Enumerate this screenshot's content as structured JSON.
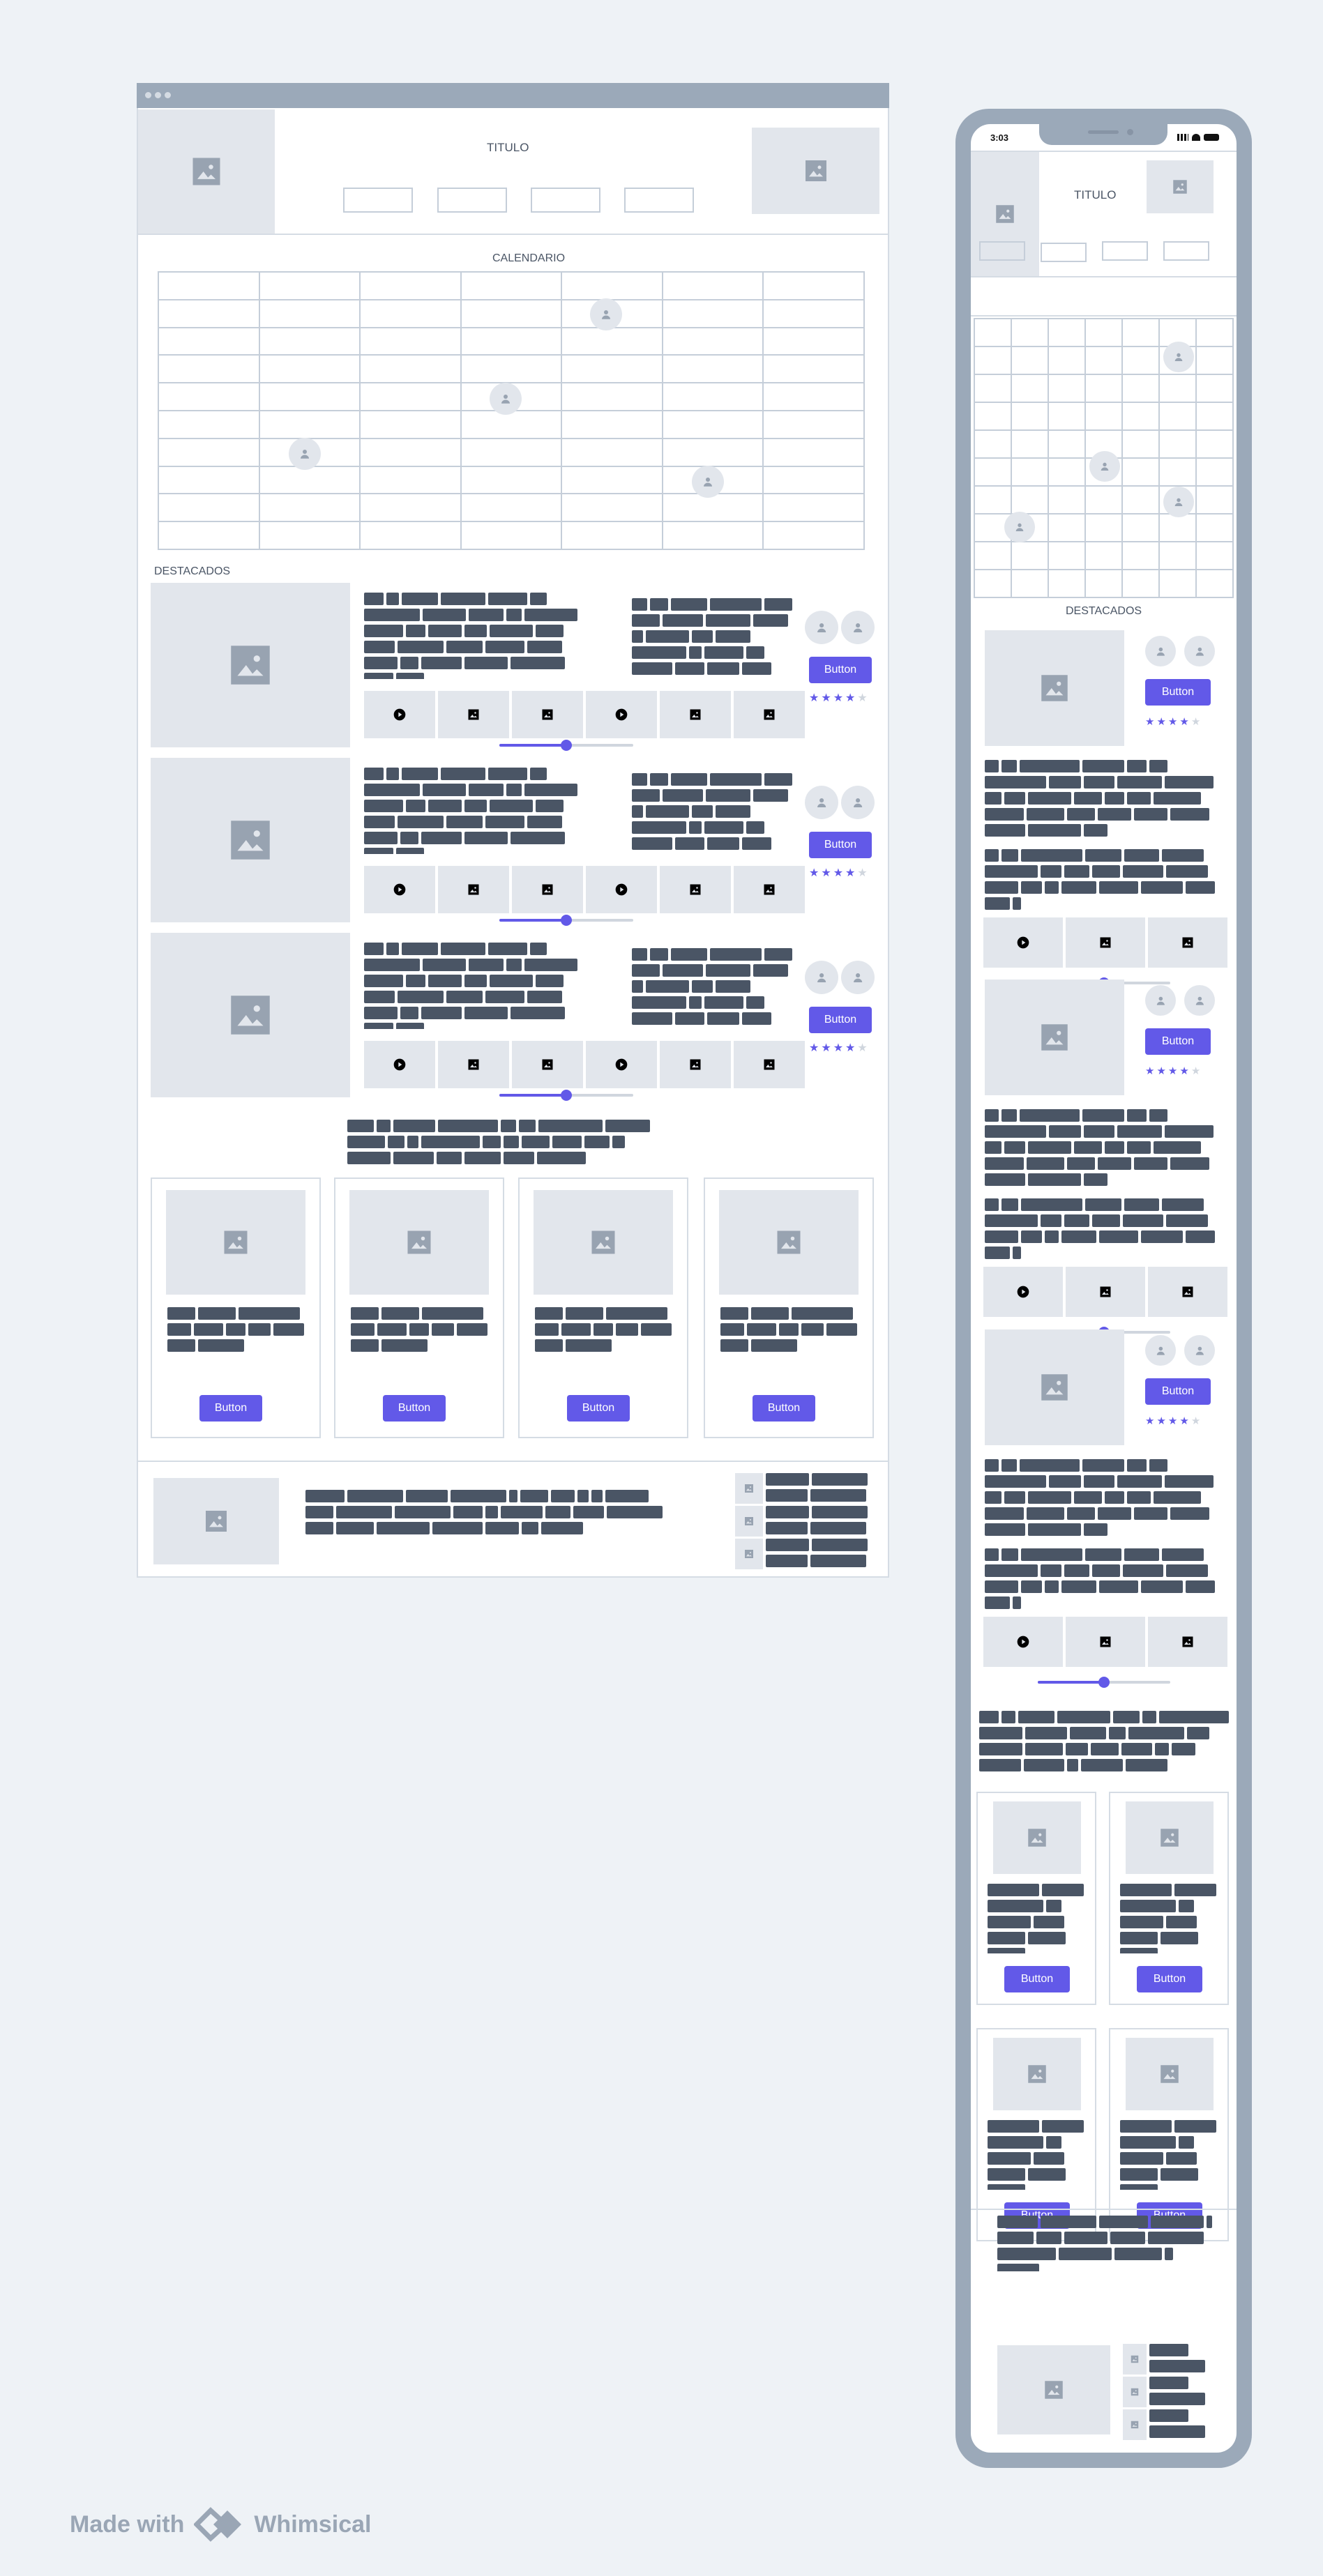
{
  "desktop": {
    "header": {
      "title": "TITULO"
    },
    "calendar": {
      "title": "CALENDARIO"
    },
    "featured": {
      "title": "DESTACADOS"
    },
    "items": [
      {
        "button_label": "Button",
        "rating": 4
      },
      {
        "button_label": "Button",
        "rating": 4
      },
      {
        "button_label": "Button",
        "rating": 4
      }
    ],
    "cards": [
      {
        "button_label": "Button"
      },
      {
        "button_label": "Button"
      },
      {
        "button_label": "Button"
      },
      {
        "button_label": "Button"
      }
    ]
  },
  "mobile": {
    "status_time": "3:03",
    "header": {
      "title": "TITULO"
    },
    "featured": {
      "title": "DESTACADOS"
    },
    "items": [
      {
        "button_label": "Button",
        "rating": 4
      },
      {
        "button_label": "Button",
        "rating": 4
      },
      {
        "button_label": "Button",
        "rating": 4
      }
    ],
    "cards": [
      {
        "button_label": "Button"
      },
      {
        "button_label": "Button"
      },
      {
        "button_label": "Button"
      },
      {
        "button_label": "Button"
      }
    ]
  },
  "footer_brand": {
    "made_with": "Made with",
    "brand": "Whimsical"
  },
  "colors": {
    "accent": "#6259e8",
    "frame": "#9ba9b9",
    "placeholder": "#e2e6ec",
    "text_block": "#4a5565"
  },
  "icons": [
    "image-icon",
    "user-icon",
    "play-icon",
    "star-icon"
  ]
}
